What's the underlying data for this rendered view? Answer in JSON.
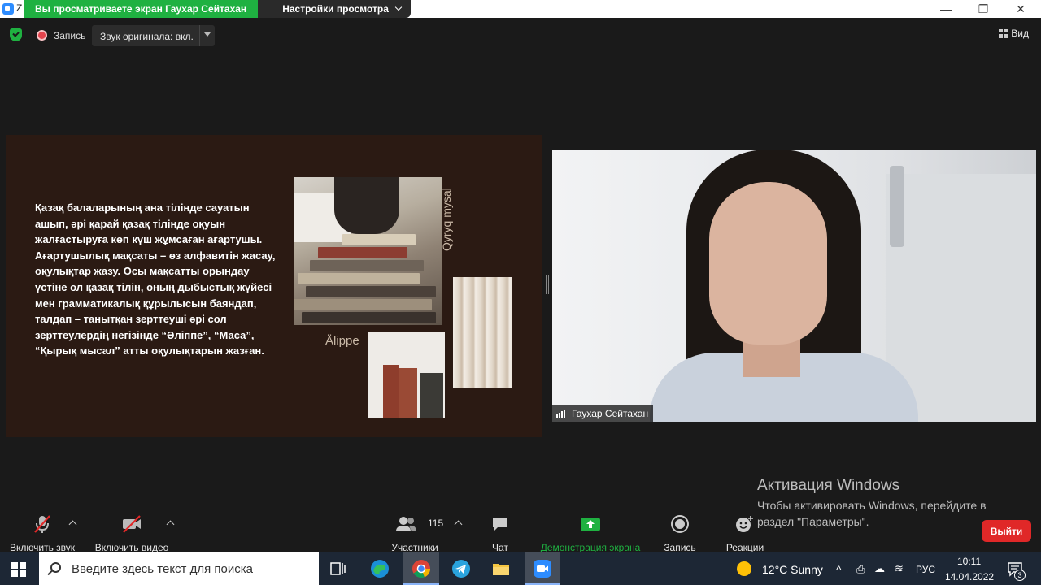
{
  "titlebar": {
    "app_letter": "Z",
    "minimize": "—",
    "maximize": "❐",
    "close": "✕"
  },
  "share_banner": {
    "viewing_text": "Вы просматриваете экран Гаухар Сейтахан",
    "settings_label": "Настройки просмотра"
  },
  "meeting_bar": {
    "recording_label": "Запись",
    "original_sound_label": "Звук оригинала: вкл.",
    "view_label": "Вид"
  },
  "slide": {
    "body_text": "Қазақ балаларының ана тілінде сауатын ашып, әрі қарай қазақ тілінде оқуын жалғастыруға көп күш жұмсаған ағартушы. Ағартушылық мақсаты – өз алфавитін жасау, оқулықтар жазу. Осы мақсатты орындау үстіне ол қазақ тілін, оның дыбыстық жүйесі мен грамматикалық құрылысын баяндап, талдап – танытқан зерттеуші әрі сол зерттеулердің негізінде “Әліппе”, “Маса”, “Қырық мысал” атты оқулықтарын жазған.",
    "vertical_label": "Qyryq mysal",
    "label_2": "Älippe"
  },
  "video": {
    "participant_name": "Гаухар Сейтахан"
  },
  "activation": {
    "title": "Активация Windows",
    "text": "Чтобы активировать Windows, перейдите в раздел \"Параметры\"."
  },
  "toolbar": {
    "unmute_label": "Включить звук",
    "start_video_label": "Включить видео",
    "participants_label": "Участники",
    "participants_count": "115",
    "chat_label": "Чат",
    "share_label": "Демонстрация экрана",
    "record_label": "Запись",
    "reactions_label": "Реакции",
    "leave_label": "Выйти",
    "share_color": "#1fb141",
    "leave_color": "#e02828"
  },
  "taskbar": {
    "search_placeholder": "Введите здесь текст для поиска",
    "weather": "12°C  Sunny",
    "language": "РУС",
    "time": "10:11",
    "date": "14.04.2022",
    "notification_count": "3"
  }
}
